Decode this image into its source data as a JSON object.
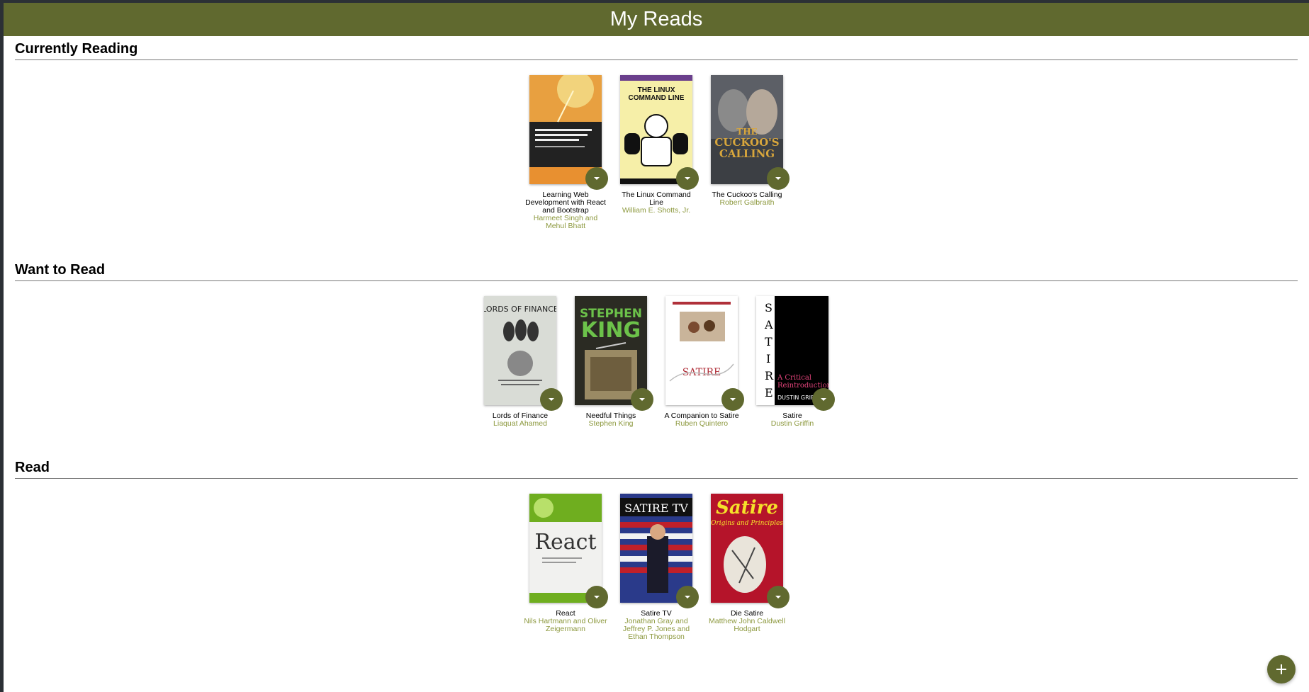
{
  "app": {
    "title": "My Reads"
  },
  "shelves": [
    {
      "title": "Currently Reading",
      "books": [
        {
          "title": "Learning Web Development with React and Bootstrap",
          "authors": "Harmeet Singh and Mehul Bhatt"
        },
        {
          "title": "The Linux Command Line",
          "authors": "William E. Shotts, Jr."
        },
        {
          "title": "The Cuckoo's Calling",
          "authors": "Robert Galbraith"
        }
      ]
    },
    {
      "title": "Want to Read",
      "books": [
        {
          "title": "Lords of Finance",
          "authors": "Liaquat Ahamed"
        },
        {
          "title": "Needful Things",
          "authors": "Stephen King"
        },
        {
          "title": "A Companion to Satire",
          "authors": "Ruben Quintero"
        },
        {
          "title": "Satire",
          "authors": "Dustin Griffin"
        }
      ]
    },
    {
      "title": "Read",
      "books": [
        {
          "title": "React",
          "authors": "Nils Hartmann and Oliver Zeigermann"
        },
        {
          "title": "Satire TV",
          "authors": "Jonathan Gray and Jeffrey P. Jones and Ethan Thompson"
        },
        {
          "title": "Die Satire",
          "authors": "Matthew John Caldwell Hodgart"
        }
      ]
    }
  ],
  "covers": {
    "linux": {
      "line1": "THE LINUX",
      "line2": "COMMAND LINE"
    },
    "cuckoo": {
      "line1": "THE",
      "line2": "CUCKOO'S",
      "line3": "CALLING"
    },
    "lords": {
      "line1": "LORDS OF FINANCE"
    },
    "king": {
      "line1": "STEPHEN",
      "line2": "KING"
    },
    "companion": {
      "line1": "SATIRE"
    },
    "satire": {
      "letters": "SATIRE",
      "line1": "A Critical",
      "line2": "Reintroduction",
      "line3": "DUSTIN GRIF"
    },
    "react": {
      "line1": "React"
    },
    "satiretv": {
      "line1": "SATIRE TV"
    },
    "diesatire": {
      "line1": "Satire",
      "line2": "Origins and Principles"
    }
  },
  "colors": {
    "header": "#60692f",
    "author": "#8d993f",
    "fab": "#60692f"
  },
  "icons": {
    "shelf_changer": "arrow-drop-down-icon",
    "add": "plus-icon"
  }
}
